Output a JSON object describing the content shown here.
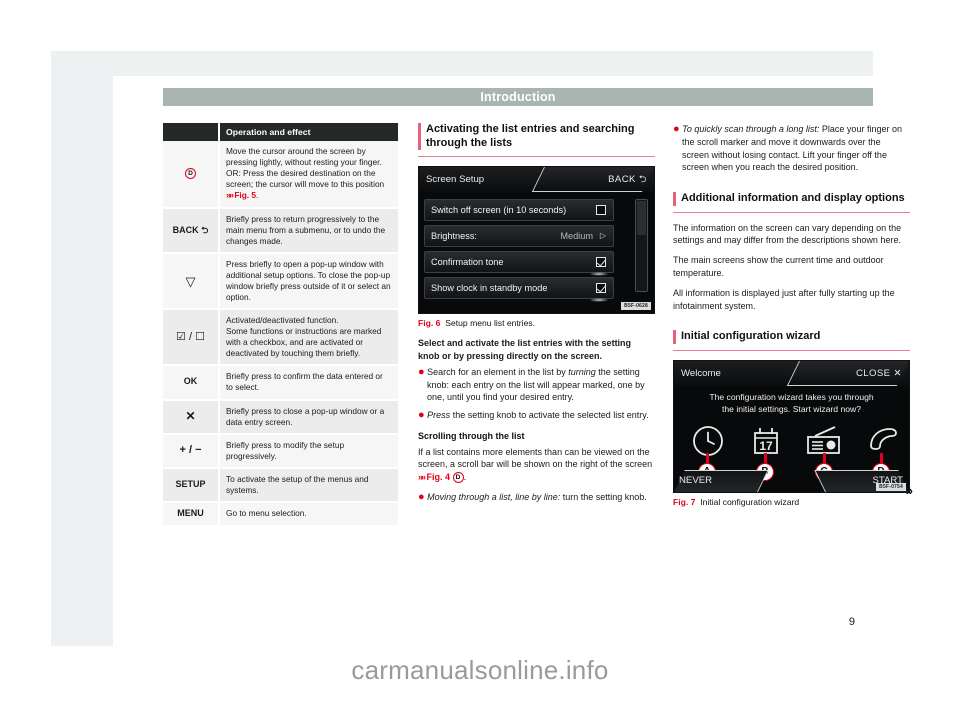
{
  "header": {
    "title": "Introduction"
  },
  "page_number": "9",
  "jump_marker": "»",
  "watermark": "carmanualsonline.info",
  "table": {
    "columns": [
      "",
      "Operation and effect"
    ],
    "rows": [
      {
        "key": "D",
        "key_type": "circle-letter",
        "text": "Move the cursor around the screen by pressing lightly, without resting your finger. OR: Press the desired destination on the screen; the cursor will move to this position ",
        "ref": "Fig. 5",
        "ref_suffix": ".",
        "shaded": false
      },
      {
        "key": "BACK  ⮌",
        "key_type": "text",
        "text": "Briefly press to return progressively to the main menu from a submenu, or to undo the changes made.",
        "shaded": true
      },
      {
        "key": "▽",
        "key_type": "text",
        "text": "Press briefly to open a pop-up window with additional setup options. To close the pop-up window briefly press outside of it or select an option.",
        "shaded": false
      },
      {
        "key": "☑ / ☐",
        "key_type": "text",
        "text": "Activated/deactivated function.\nSome functions or instructions are marked with a checkbox, and are activated or deactivated by touching them briefly.",
        "shaded": true
      },
      {
        "key": "OK",
        "key_type": "text",
        "text": "Briefly press to confirm the data entered or to select.",
        "shaded": false
      },
      {
        "key": "✕",
        "key_type": "text",
        "text": "Briefly press to close a pop-up window or a data entry screen.",
        "shaded": true
      },
      {
        "key": "+ / −",
        "key_type": "text",
        "text": "Briefly press to modify the setup progressively.",
        "shaded": false
      },
      {
        "key": "SETUP",
        "key_type": "text",
        "text": "To activate the setup of the menus and systems.",
        "shaded": true
      },
      {
        "key": "MENU",
        "key_type": "text",
        "text": "Go to menu selection.",
        "shaded": false
      }
    ]
  },
  "section_activating": {
    "heading": "Activating the list entries and searching through the lists",
    "lead": "Select and activate the list entries with the setting knob or by pressing directly on the screen.",
    "bullet1_italic": "turning",
    "bullet1_pre": "Search for an element in the list by ",
    "bullet1_post": " the setting knob: each entry on the list will appear marked, one by one, until you find your desired entry.",
    "bullet2_italic": "Press",
    "bullet2_post": " the setting knob to activate the selected list entry.",
    "sub_scrolling": "Scrolling through the list",
    "scroll_text_pre": "If a list contains more elements than can be viewed on the screen, a scroll bar will be shown on the right of the screen ",
    "scroll_ref": "Fig. 4",
    "scroll_ref_letter": "D",
    "scroll_text_post": ".",
    "bullet3_italic": "Moving through a list, line by line:",
    "bullet3_post": " turn the setting knob."
  },
  "section_right": {
    "bullet4_italic": "To quickly scan through a long list:",
    "bullet4_post": " Place your finger on the scroll marker and move it downwards over the screen without losing contact. Lift your finger off the screen when you reach the desired position.",
    "heading_additional": "Additional information and display options",
    "para1": "The information on the screen can vary depending on the settings and may differ from the descriptions shown here.",
    "para2": "The main screens show the current time and outdoor temperature.",
    "para3": "All information is displayed just after fully starting up the infotainment system.",
    "heading_wizard": "Initial configuration wizard"
  },
  "figure6": {
    "label": "Fig. 6",
    "caption": "Setup menu list entries.",
    "code": "B5F-0628",
    "screen": {
      "title": "Screen Setup",
      "back_label": "BACK",
      "back_icon": "⮌",
      "items": [
        {
          "label": "Switch off screen (in 10 seconds)",
          "control": "checkbox",
          "checked": false
        },
        {
          "label": "Brightness:",
          "control": "value-arrow",
          "value": "Medium",
          "arrow": "▷"
        },
        {
          "label": "Confirmation tone",
          "control": "checkbox",
          "checked": true
        },
        {
          "label": "Show clock in standby mode",
          "control": "checkbox",
          "checked": true
        }
      ]
    }
  },
  "figure7": {
    "label": "Fig. 7",
    "caption": "Initial configuration wizard",
    "code": "B5F-0754",
    "screen": {
      "title": "Welcome",
      "close_label": "CLOSE",
      "close_icon": "✕",
      "message_line1": "The configuration wizard takes you through",
      "message_line2": "the initial settings. Start wizard now?",
      "icons": [
        {
          "marker": "A",
          "icon": "clock-icon",
          "glyph": "🕐"
        },
        {
          "marker": "B",
          "icon": "calendar-icon",
          "glyph": "17"
        },
        {
          "marker": "C",
          "icon": "radio-icon",
          "glyph": "radio"
        },
        {
          "marker": "D",
          "icon": "phone-icon",
          "glyph": "phone"
        }
      ],
      "never_label": "NEVER",
      "start_label": "START"
    }
  }
}
